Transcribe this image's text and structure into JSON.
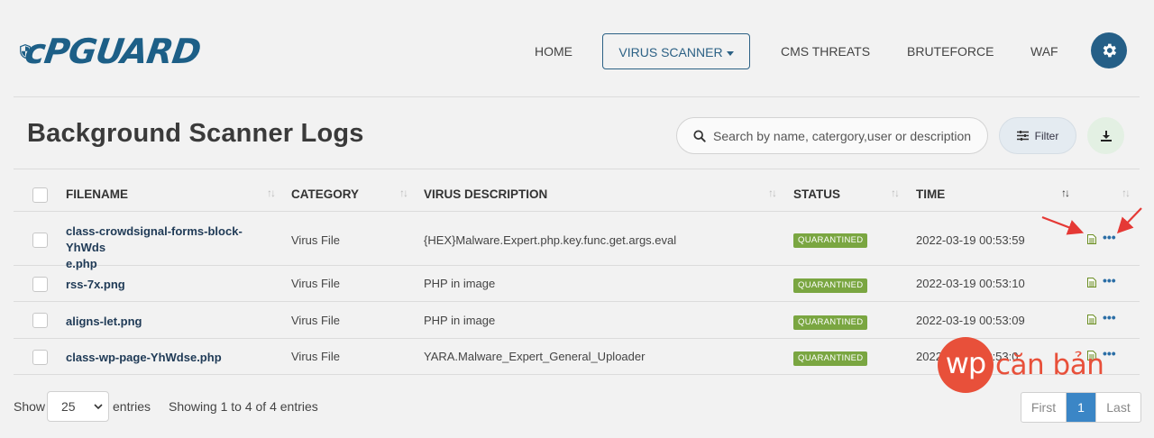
{
  "brand": {
    "name": "cPGuard",
    "logo_text": "cPGUARD",
    "color": "#1d5f87"
  },
  "nav": {
    "items": [
      {
        "label": "HOME",
        "active": false
      },
      {
        "label": "VIRUS SCANNER",
        "active": true,
        "dropdown": true
      },
      {
        "label": "CMS THREATS",
        "active": false
      },
      {
        "label": "BRUTEFORCE",
        "active": false
      },
      {
        "label": "WAF",
        "active": false
      }
    ],
    "settings_icon": "gear-icon"
  },
  "page": {
    "title": "Background Scanner Logs",
    "search_placeholder": "Search by name, catergory,user or description",
    "filter_label": "Filter",
    "download_icon": "download-icon"
  },
  "table": {
    "columns": [
      "FILENAME",
      "CATEGORY",
      "VIRUS DESCRIPTION",
      "STATUS",
      "TIME"
    ],
    "rows": [
      {
        "filename_line1": "class-crowdsignal-forms-block-YhWds",
        "filename_line2": "e.php",
        "category": "Virus File",
        "description": "{HEX}Malware.Expert.php.key.func.get.args.eval",
        "status": "QUARANTINED",
        "time": "2022-03-19 00:53:59"
      },
      {
        "filename_line1": "rss-7x.png",
        "filename_line2": "",
        "category": "Virus File",
        "description": "PHP in image",
        "status": "QUARANTINED",
        "time": "2022-03-19 00:53:10"
      },
      {
        "filename_line1": "aligns-let.png",
        "filename_line2": "",
        "category": "Virus File",
        "description": "PHP in image",
        "status": "QUARANTINED",
        "time": "2022-03-19 00:53:09"
      },
      {
        "filename_line1": "class-wp-page-YhWdse.php",
        "filename_line2": "",
        "category": "Virus File",
        "description": "YARA.Malware_Expert_General_Uploader",
        "status": "QUARANTINED",
        "time": "2022-03-19 00:53:0"
      }
    ],
    "status_color": "#7aa641",
    "action_icons": [
      "document-icon",
      "more-dots-icon"
    ]
  },
  "footer": {
    "show_label": "Show",
    "entries_value": "25",
    "entries_label": "entries",
    "info": "Showing 1 to 4 of 4 entries",
    "pagination": {
      "first": "First",
      "current": "1",
      "last": "Last"
    }
  },
  "watermark": {
    "circle_text": "wp",
    "text": "căn bản",
    "color": "#e8503a"
  }
}
